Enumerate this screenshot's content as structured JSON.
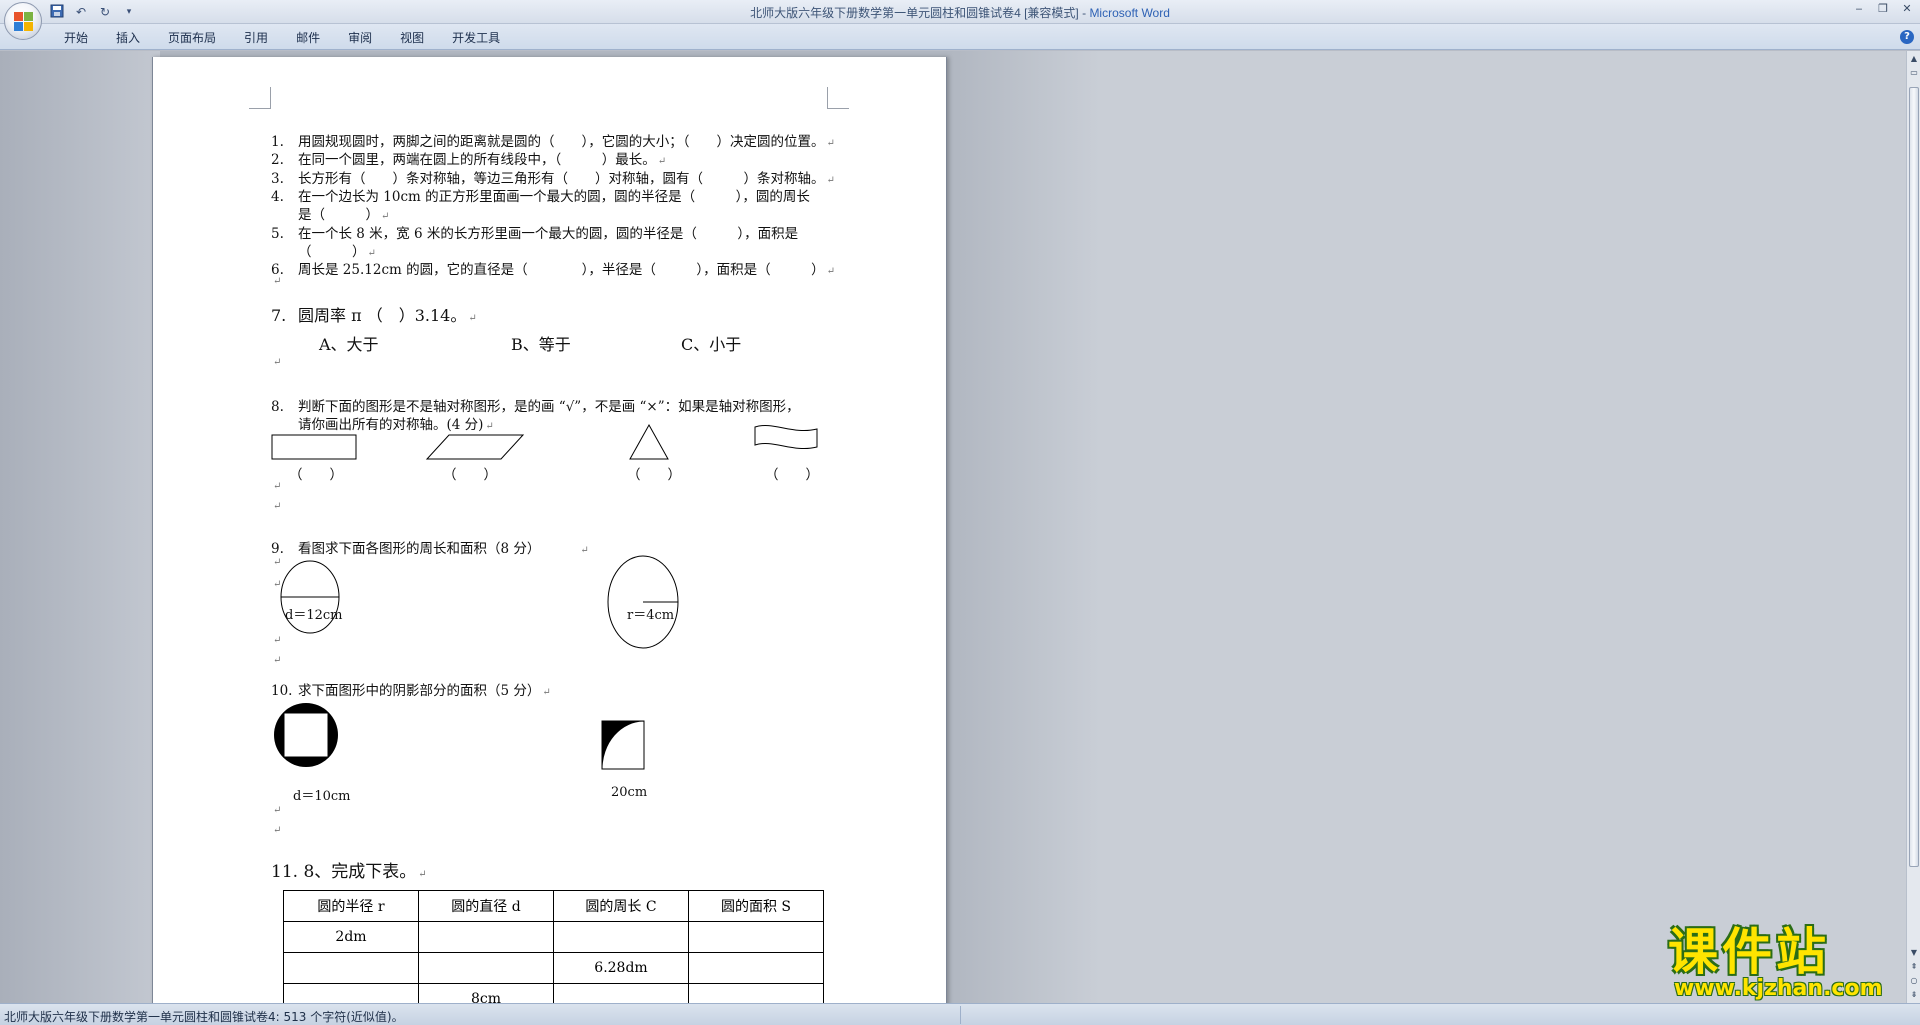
{
  "window": {
    "title": "北师大版六年级下册数学第一单元圆柱和圆锥试卷4 [兼容模式]",
    "separator": " - ",
    "app_name": "Microsoft Word"
  },
  "ribbon": {
    "tabs": [
      "开始",
      "插入",
      "页面布局",
      "引用",
      "邮件",
      "审阅",
      "视图",
      "开发工具"
    ]
  },
  "document": {
    "questions": [
      {
        "num": "1.",
        "text": "用圆规现圆时，两脚之间的距离就是圆的（　　），它圆的大小；（　　）决定圆的位置。"
      },
      {
        "num": "2.",
        "text": "在同一个圆里，两端在圆上的所有线段中，（　　　）最长。"
      },
      {
        "num": "3.",
        "text": "长方形有（　　）条对称轴，等边三角形有（　　）对称轴，圆有（　　　）条对称轴。"
      },
      {
        "num": "4.",
        "text": "在一个边长为 10cm 的正方形里面画一个最大的圆，圆的半径是（　　　），圆的周长",
        "cont": "是（　　　）"
      },
      {
        "num": "5.",
        "text": "在一个长 8 米，宽 6 米的长方形里画一个最大的圆，圆的半径是（　　　），面积是",
        "cont": "（　　　）"
      },
      {
        "num": "6.",
        "text": "周长是 25.12cm 的圆，它的直径是（　　　　），半径是（　　　），面积是（　　　）"
      }
    ],
    "q7": {
      "num": "7.",
      "text": "圆周率 π （　）3.14。",
      "options": [
        "A、大于",
        "B、等于",
        "C、小于"
      ]
    },
    "q8": {
      "num": "8.",
      "line1": "判断下面的图形是不是轴对称图形，是的画 “√”，不是画 “×”：如果是轴对称图形，",
      "line2": "请你画出所有的对称轴。(4 分)",
      "blank": "（　　）"
    },
    "q9": {
      "num": "9.",
      "text": "看图求下面各图形的周长和面积（8 分）",
      "label_left": "d＝12cm",
      "label_right": "r＝4cm"
    },
    "q10": {
      "num": "10.",
      "text": "求下面图形中的阴影部分的面积（5 分）",
      "label_left": "d＝10cm",
      "label_right": "20cm"
    },
    "q11": {
      "title": "11. 8、完成下表。",
      "headers": [
        "圆的半径 r",
        "圆的直径 d",
        "圆的周长 C",
        "圆的面积 S"
      ],
      "rows": [
        [
          "2dm",
          "",
          "",
          ""
        ],
        [
          "",
          "",
          "6.28dm",
          ""
        ],
        [
          "",
          "8cm",
          "",
          ""
        ]
      ]
    }
  },
  "statusbar": {
    "text": "北师大版六年级下册数学第一单元圆柱和圆锥试卷4: 513 个字符(近似值)。"
  },
  "watermark": {
    "main": "课件站",
    "url": "www.kjzhan.com"
  }
}
